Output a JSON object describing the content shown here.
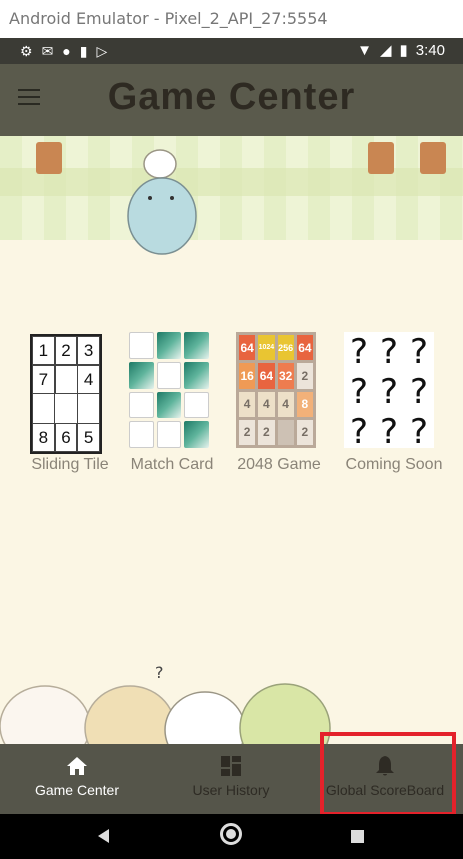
{
  "window": {
    "title": "Android Emulator - Pixel_2_API_27:5554"
  },
  "status_bar": {
    "left_icons": [
      "gear-icon",
      "gmail-icon",
      "circle-icon",
      "sd-card-icon",
      "play-store-icon"
    ],
    "right_icons": [
      "wifi-icon",
      "signal-icon",
      "battery-icon"
    ],
    "time": "3:40"
  },
  "app_bar": {
    "title": "Game Center",
    "menu_icon": "hamburger-menu-icon"
  },
  "games": [
    {
      "label": "Sliding Tile",
      "tiles": [
        "1",
        "2",
        "3",
        "7",
        "",
        "4",
        "",
        "",
        "",
        "8",
        "6",
        "5"
      ]
    },
    {
      "label": "Match Card"
    },
    {
      "label": "2048 Game",
      "tiles": [
        "64",
        "1024",
        "256",
        "64",
        "16",
        "64",
        "32",
        "2",
        "4",
        "4",
        "4",
        "8",
        "2",
        "2",
        "",
        "2"
      ]
    },
    {
      "label": "Coming Soon",
      "tiles": [
        "?",
        "?",
        "?",
        "?",
        "?",
        "?",
        "?",
        "?",
        "?"
      ]
    }
  ],
  "bottom_nav": {
    "items": [
      {
        "label": "Game Center",
        "icon": "home-icon",
        "active": true
      },
      {
        "label": "User History",
        "icon": "dashboard-icon",
        "active": false
      },
      {
        "label": "Global ScoreBoard",
        "icon": "bell-icon",
        "active": false
      }
    ]
  },
  "colors": {
    "app_bar": "#5a5a4c",
    "bottom_nav": "#55554a",
    "highlight": "#e4222b",
    "content_bg": "#fbf6e4"
  }
}
